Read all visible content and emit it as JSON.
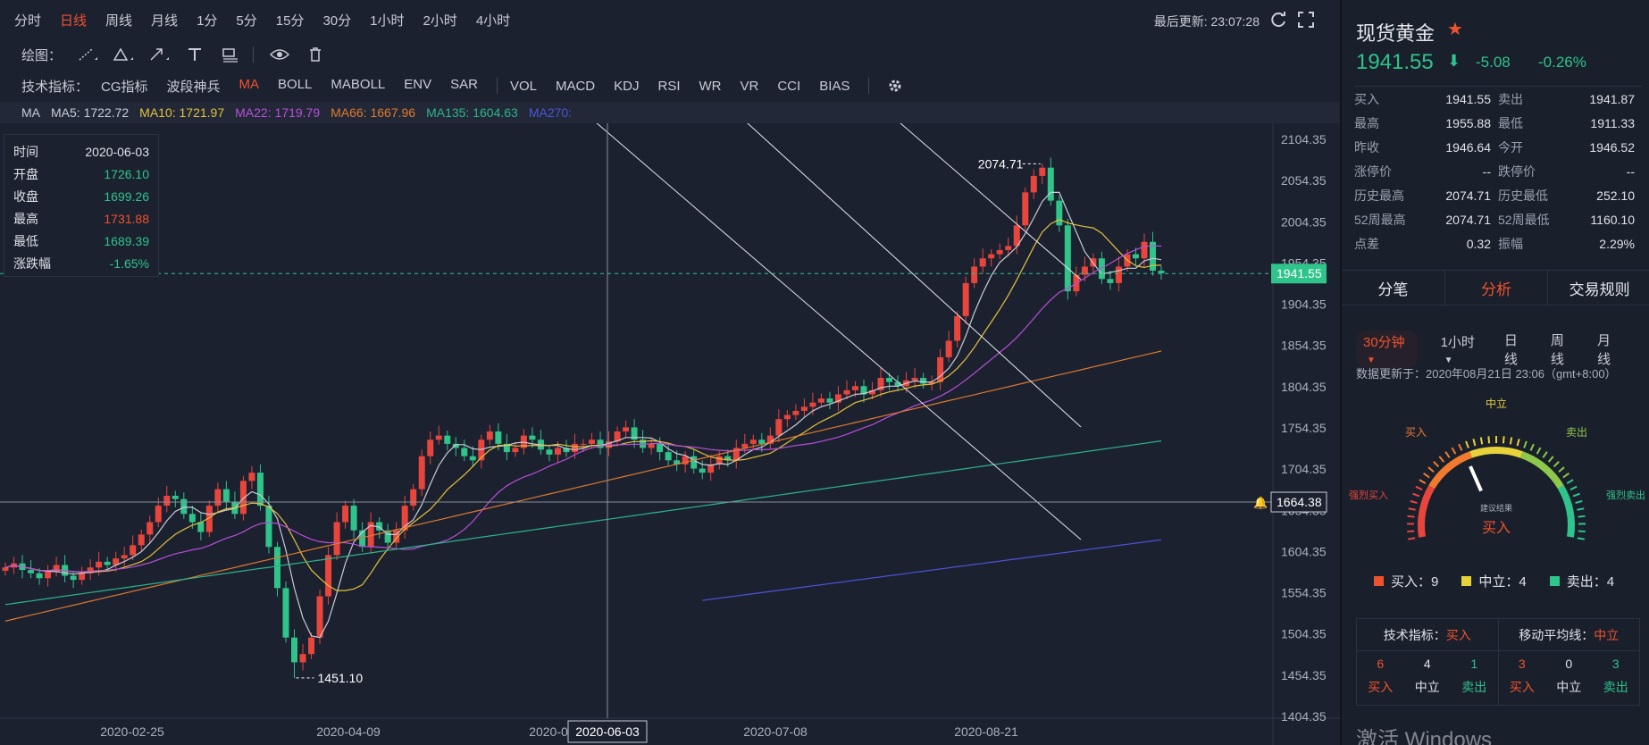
{
  "toolbar": {
    "periods": [
      "分时",
      "日线",
      "周线",
      "月线",
      "1分",
      "5分",
      "15分",
      "30分",
      "1小时",
      "2小时",
      "4小时"
    ],
    "active_period_index": 1,
    "last_update_label": "最后更新: 23:07:28",
    "draw_label": "绘图：",
    "indicator_label": "技术指标：",
    "indicators_main": [
      "CG指标",
      "波段神兵",
      "MA",
      "BOLL",
      "MABOLL",
      "ENV",
      "SAR"
    ],
    "indicators_sub": [
      "VOL",
      "MACD",
      "KDJ",
      "RSI",
      "WR",
      "VR",
      "CCI",
      "BIAS"
    ],
    "active_indicator": "MA"
  },
  "ma_legend": {
    "title": "MA",
    "items": [
      {
        "label": "MA5: 1722.72",
        "color": "#c9ccd6"
      },
      {
        "label": "MA10: 1721.97",
        "color": "#e3c23b"
      },
      {
        "label": "MA22: 1719.79",
        "color": "#b84fd8"
      },
      {
        "label": "MA66: 1667.96",
        "color": "#e07a2e"
      },
      {
        "label": "MA135: 1604.63",
        "color": "#2db48a"
      },
      {
        "label": "MA270:",
        "color": "#4a55d8"
      }
    ]
  },
  "info_box": {
    "rows": [
      {
        "label": "时间",
        "value": "2020-06-03",
        "color": "#dfe2e8"
      },
      {
        "label": "开盘",
        "value": "1726.10",
        "color": "#2ec48a"
      },
      {
        "label": "收盘",
        "value": "1699.26",
        "color": "#2ec48a"
      },
      {
        "label": "最高",
        "value": "1731.88",
        "color": "#f0522d"
      },
      {
        "label": "最低",
        "value": "1689.39",
        "color": "#2ec48a"
      },
      {
        "label": "涨跌幅",
        "value": "-1.65%",
        "color": "#2ec48a"
      }
    ]
  },
  "chart_data": {
    "type": "candlestick",
    "y_ticks": [
      "2104.35",
      "2054.35",
      "2004.35",
      "1954.35",
      "1904.35",
      "1854.35",
      "1804.35",
      "1754.35",
      "1704.35",
      "1654.35",
      "1604.35",
      "1554.35",
      "1504.35",
      "1454.35",
      "1404.35"
    ],
    "ylim": [
      1404.35,
      2104.35
    ],
    "x_ticks": [
      "2020-02-25",
      "2020-04-09",
      "2020-0",
      "2020-07-08",
      "2020-08-21"
    ],
    "crosshair_date_label": "2020-06-03",
    "crosshair_price_label": "1664.38",
    "current_price_label": "1941.55",
    "current_price": 1941.55,
    "crosshair_price": 1664.38,
    "high_annotation": "2074.71",
    "low_annotation": "1451.10",
    "colors": {
      "up": "#e8453c",
      "down": "#2ec48a"
    },
    "closes": [
      1585,
      1590,
      1582,
      1578,
      1572,
      1580,
      1588,
      1575,
      1570,
      1578,
      1585,
      1592,
      1588,
      1596,
      1600,
      1612,
      1625,
      1640,
      1660,
      1672,
      1668,
      1650,
      1640,
      1628,
      1660,
      1680,
      1665,
      1650,
      1690,
      1700,
      1660,
      1610,
      1560,
      1500,
      1470,
      1480,
      1500,
      1550,
      1600,
      1640,
      1660,
      1630,
      1610,
      1640,
      1630,
      1615,
      1630,
      1660,
      1680,
      1720,
      1740,
      1745,
      1735,
      1730,
      1720,
      1715,
      1740,
      1750,
      1735,
      1725,
      1730,
      1745,
      1740,
      1728,
      1722,
      1730,
      1725,
      1735,
      1735,
      1740,
      1730,
      1738,
      1750,
      1755,
      1740,
      1730,
      1735,
      1725,
      1715,
      1710,
      1720,
      1705,
      1700,
      1710,
      1720,
      1715,
      1730,
      1735,
      1740,
      1735,
      1745,
      1765,
      1770,
      1775,
      1780,
      1785,
      1790,
      1785,
      1795,
      1800,
      1805,
      1795,
      1800,
      1815,
      1810,
      1805,
      1812,
      1815,
      1808,
      1810,
      1840,
      1860,
      1890,
      1930,
      1950,
      1960,
      1965,
      1970,
      1975,
      2000,
      2040,
      2060,
      2070,
      2030,
      2000,
      1920,
      1940,
      1950,
      1960,
      1935,
      1930,
      1950,
      1965,
      1960,
      1980,
      1945,
      1942
    ],
    "ma_series": [
      {
        "name": "MA5",
        "color": "#c9ccd6"
      },
      {
        "name": "MA10",
        "color": "#e3c23b"
      },
      {
        "name": "MA22",
        "color": "#b84fd8"
      },
      {
        "name": "MA66",
        "color": "#e07a2e"
      },
      {
        "name": "MA135",
        "color": "#2db48a"
      },
      {
        "name": "MA270",
        "color": "#4a55d8"
      }
    ]
  },
  "instrument": {
    "name": "现货黄金",
    "price": "1941.55",
    "change": "-5.08",
    "change_pct": "-0.26%"
  },
  "quote_rows": [
    [
      {
        "l": "买入",
        "v": "1941.55"
      },
      {
        "l": "卖出",
        "v": "1941.87"
      }
    ],
    [
      {
        "l": "最高",
        "v": "1955.88"
      },
      {
        "l": "最低",
        "v": "1911.33"
      }
    ],
    [
      {
        "l": "昨收",
        "v": "1946.64"
      },
      {
        "l": "今开",
        "v": "1946.52"
      }
    ],
    [
      {
        "l": "涨停价",
        "v": "--"
      },
      {
        "l": "跌停价",
        "v": "--"
      }
    ],
    [
      {
        "l": "历史最高",
        "v": "2074.71"
      },
      {
        "l": "历史最低",
        "v": "252.10"
      }
    ],
    [
      {
        "l": "52周最高",
        "v": "2074.71"
      },
      {
        "l": "52周最低",
        "v": "1160.10"
      }
    ],
    [
      {
        "l": "点差",
        "v": "0.32"
      },
      {
        "l": "振幅",
        "v": "2.29%"
      }
    ]
  ],
  "panel_tabs": {
    "tab1": "分笔",
    "tab2": "分析",
    "tab3": "交易规则"
  },
  "analysis": {
    "period_options": [
      "30分钟",
      "1小时",
      "日线",
      "周线",
      "月线"
    ],
    "active_period": "30分钟",
    "update_text": "数据更新于：2020年08月21日 23:06（gmt+8:00）",
    "gauge_labels": {
      "strong_buy": "强烈买入",
      "buy": "买入",
      "neutral": "中立",
      "sell": "卖出",
      "strong_sell": "强烈卖出",
      "center_small": "建议结果",
      "result": "买入"
    },
    "gauge_level": 0.38,
    "legend": [
      {
        "label": "买入：9",
        "color": "#f0522d"
      },
      {
        "label": "中立：4",
        "color": "#e8d23a"
      },
      {
        "label": "卖出：4",
        "color": "#2ec48a"
      }
    ],
    "tech_summary": {
      "title_prefix": "技术指标：",
      "title_value": "买入",
      "nums": [
        "6",
        "4",
        "1"
      ],
      "labels": [
        "买入",
        "中立",
        "卖出"
      ]
    },
    "ma_summary": {
      "title_prefix": "移动平均线：",
      "title_value": "中立",
      "nums": [
        "3",
        "0",
        "3"
      ],
      "labels": [
        "买入",
        "中立",
        "卖出"
      ]
    }
  },
  "windows_watermark": "激活 Windows"
}
